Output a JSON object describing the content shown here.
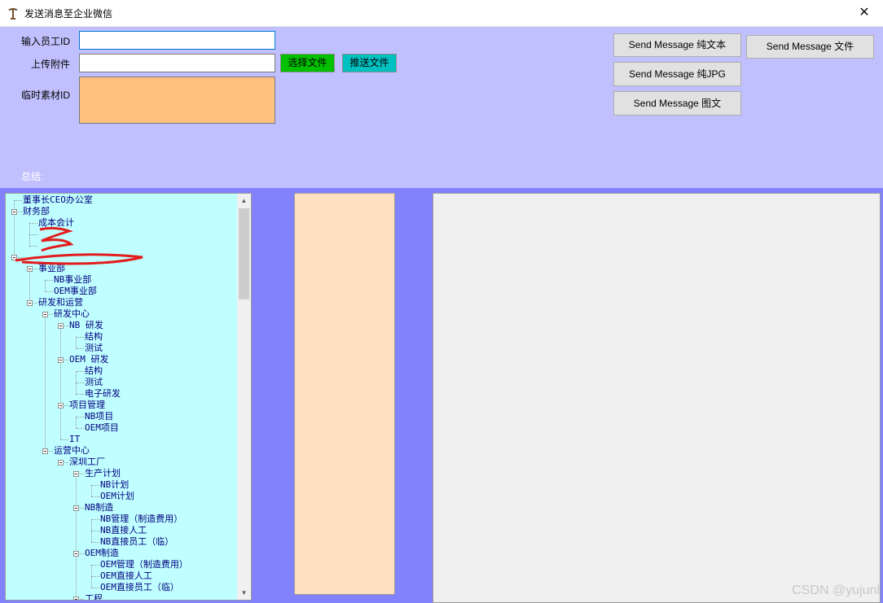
{
  "window": {
    "title": "发送消息至企业微信",
    "close_glyph": "✕",
    "icon": "tree-app-icon"
  },
  "form": {
    "employee_id_label": "输入员工ID",
    "employee_id_value": "",
    "attachment_label": "上传附件",
    "attachment_value": "",
    "media_id_label": "临时素材ID",
    "select_file_button": "选择文件",
    "push_file_button": "推送文件",
    "summary_label": "总结:"
  },
  "actions": {
    "send_text": "Send Message 纯文本",
    "send_file": "Send Message 文件",
    "send_jpg": "Send Message 纯JPG",
    "send_news": "Send Message 图文"
  },
  "tree": {
    "nodes": [
      {
        "label": "董事长CEO办公室",
        "level": 0,
        "expander": false
      },
      {
        "label": "财务部",
        "level": 0,
        "expander": true
      },
      {
        "label": "成本会计",
        "level": 1,
        "expander": false
      },
      {
        "label": "",
        "level": 1,
        "expander": false
      },
      {
        "label": "",
        "level": 1,
        "expander": false
      },
      {
        "label": "",
        "level": 0,
        "expander": true
      },
      {
        "label": "事业部",
        "level": 1,
        "expander": true
      },
      {
        "label": "NB事业部",
        "level": 2,
        "expander": false
      },
      {
        "label": "OEM事业部",
        "level": 2,
        "expander": false
      },
      {
        "label": "研发和运营",
        "level": 1,
        "expander": true
      },
      {
        "label": "研发中心",
        "level": 2,
        "expander": true
      },
      {
        "label": "NB 研发",
        "level": 3,
        "expander": true
      },
      {
        "label": "结构",
        "level": 4,
        "expander": false
      },
      {
        "label": "测试",
        "level": 4,
        "expander": false
      },
      {
        "label": "OEM 研发",
        "level": 3,
        "expander": true
      },
      {
        "label": "结构",
        "level": 4,
        "expander": false
      },
      {
        "label": "测试",
        "level": 4,
        "expander": false
      },
      {
        "label": "电子研发",
        "level": 4,
        "expander": false
      },
      {
        "label": "项目管理",
        "level": 3,
        "expander": true
      },
      {
        "label": "NB项目",
        "level": 4,
        "expander": false
      },
      {
        "label": "OEM项目",
        "level": 4,
        "expander": false
      },
      {
        "label": "IT",
        "level": 3,
        "expander": false
      },
      {
        "label": "运营中心",
        "level": 2,
        "expander": true
      },
      {
        "label": "深圳工厂",
        "level": 3,
        "expander": true
      },
      {
        "label": "生产计划",
        "level": 4,
        "expander": true
      },
      {
        "label": "NB计划",
        "level": 5,
        "expander": false
      },
      {
        "label": "OEM计划",
        "level": 5,
        "expander": false
      },
      {
        "label": "NB制造",
        "level": 4,
        "expander": true
      },
      {
        "label": "NB管理（制造费用）",
        "level": 5,
        "expander": false
      },
      {
        "label": "NB直接人工",
        "level": 5,
        "expander": false
      },
      {
        "label": "NB直接员工（临）",
        "level": 5,
        "expander": false
      },
      {
        "label": "OEM制造",
        "level": 4,
        "expander": true
      },
      {
        "label": "OEM管理（制造费用）",
        "level": 5,
        "expander": false
      },
      {
        "label": "OEM直接人工",
        "level": 5,
        "expander": false
      },
      {
        "label": "OEM直接员工（临）",
        "level": 5,
        "expander": false
      },
      {
        "label": "工程",
        "level": 4,
        "expander": true
      }
    ]
  },
  "scrollbar": {
    "up_glyph": "▲",
    "down_glyph": "▼"
  },
  "watermark": "CSDN @yujunl",
  "colors": {
    "top_panel": "#c0c0ff",
    "background": "#8282ff",
    "tree_bg": "#c0ffff",
    "media_box": "#ffc080",
    "peach_panel": "#ffe0c0",
    "select_button": "#00c000",
    "push_button": "#00c0c0"
  }
}
